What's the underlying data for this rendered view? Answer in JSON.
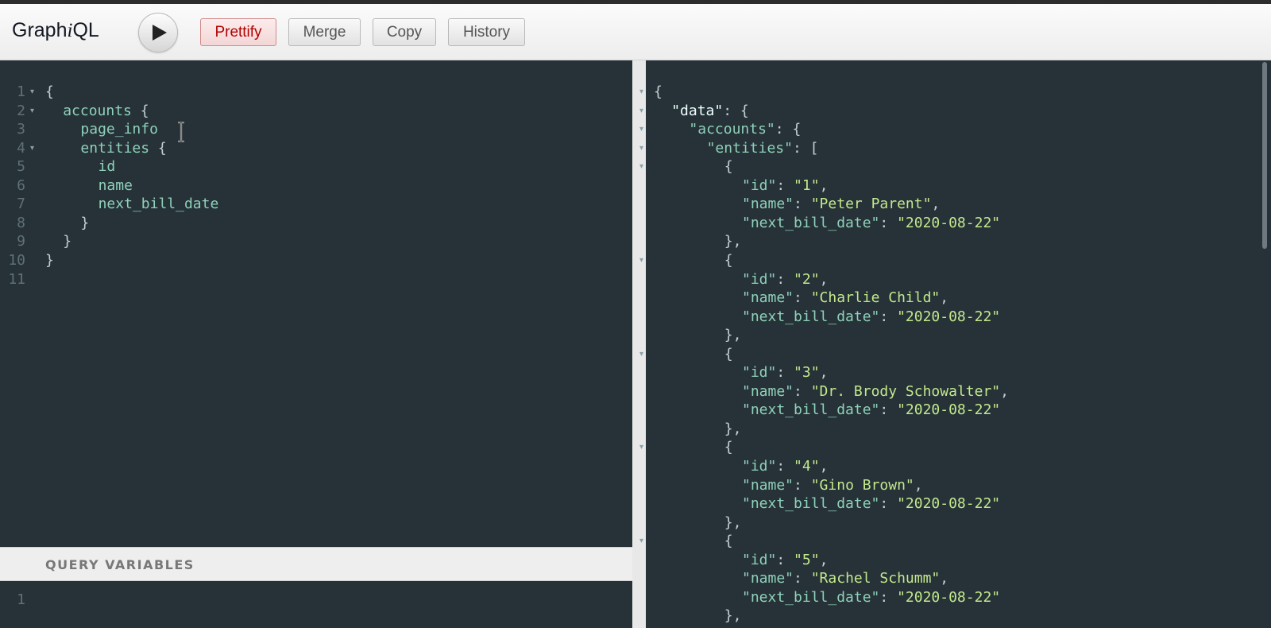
{
  "toolbar": {
    "title_pre": "Graph",
    "title_i": "i",
    "title_post": "QL",
    "buttons": {
      "prettify": "Prettify",
      "merge": "Merge",
      "copy": "Copy",
      "history": "History"
    },
    "execute_icon": "play-icon"
  },
  "query_editor": {
    "lines": [
      {
        "num": "1",
        "fold": true,
        "indent": 0,
        "tokens": [
          {
            "t": "{",
            "c": "punct"
          }
        ]
      },
      {
        "num": "2",
        "fold": true,
        "indent": 1,
        "tokens": [
          {
            "t": "accounts",
            "c": "field"
          },
          {
            "t": " {",
            "c": "punct"
          }
        ]
      },
      {
        "num": "3",
        "fold": false,
        "indent": 2,
        "tokens": [
          {
            "t": "page_info",
            "c": "field"
          }
        ]
      },
      {
        "num": "4",
        "fold": true,
        "indent": 2,
        "tokens": [
          {
            "t": "entities",
            "c": "field"
          },
          {
            "t": " {",
            "c": "punct"
          }
        ]
      },
      {
        "num": "5",
        "fold": false,
        "indent": 3,
        "tokens": [
          {
            "t": "id",
            "c": "field"
          }
        ]
      },
      {
        "num": "6",
        "fold": false,
        "indent": 3,
        "tokens": [
          {
            "t": "name",
            "c": "field"
          }
        ]
      },
      {
        "num": "7",
        "fold": false,
        "indent": 3,
        "tokens": [
          {
            "t": "next_bill_date",
            "c": "field"
          }
        ]
      },
      {
        "num": "8",
        "fold": false,
        "indent": 2,
        "tokens": [
          {
            "t": "}",
            "c": "punct"
          }
        ]
      },
      {
        "num": "9",
        "fold": false,
        "indent": 1,
        "tokens": [
          {
            "t": "}",
            "c": "punct"
          }
        ]
      },
      {
        "num": "10",
        "fold": false,
        "indent": 0,
        "tokens": [
          {
            "t": "}",
            "c": "punct"
          }
        ]
      },
      {
        "num": "11",
        "fold": false,
        "indent": 0,
        "tokens": []
      }
    ]
  },
  "query_variables": {
    "title": "QUERY VARIABLES",
    "lines": [
      {
        "num": "1"
      }
    ]
  },
  "result": {
    "lines": [
      {
        "fold": true,
        "indent": 0,
        "tokens": [
          {
            "t": "{",
            "c": "punct"
          }
        ]
      },
      {
        "fold": true,
        "indent": 1,
        "tokens": [
          {
            "t": "\"data\"",
            "c": "root"
          },
          {
            "t": ": {",
            "c": "punct"
          }
        ]
      },
      {
        "fold": true,
        "indent": 2,
        "tokens": [
          {
            "t": "\"accounts\"",
            "c": "key"
          },
          {
            "t": ": {",
            "c": "punct"
          }
        ]
      },
      {
        "fold": true,
        "indent": 3,
        "tokens": [
          {
            "t": "\"entities\"",
            "c": "key"
          },
          {
            "t": ": [",
            "c": "punct"
          }
        ]
      },
      {
        "fold": true,
        "indent": 4,
        "tokens": [
          {
            "t": "{",
            "c": "punct"
          }
        ]
      },
      {
        "fold": false,
        "indent": 5,
        "tokens": [
          {
            "t": "\"id\"",
            "c": "key"
          },
          {
            "t": ": ",
            "c": "punct"
          },
          {
            "t": "\"1\"",
            "c": "str"
          },
          {
            "t": ",",
            "c": "punct"
          }
        ]
      },
      {
        "fold": false,
        "indent": 5,
        "tokens": [
          {
            "t": "\"name\"",
            "c": "key"
          },
          {
            "t": ": ",
            "c": "punct"
          },
          {
            "t": "\"Peter Parent\"",
            "c": "str"
          },
          {
            "t": ",",
            "c": "punct"
          }
        ]
      },
      {
        "fold": false,
        "indent": 5,
        "tokens": [
          {
            "t": "\"next_bill_date\"",
            "c": "key"
          },
          {
            "t": ": ",
            "c": "punct"
          },
          {
            "t": "\"2020-08-22\"",
            "c": "str"
          }
        ]
      },
      {
        "fold": false,
        "indent": 4,
        "tokens": [
          {
            "t": "},",
            "c": "punct"
          }
        ]
      },
      {
        "fold": true,
        "indent": 4,
        "tokens": [
          {
            "t": "{",
            "c": "punct"
          }
        ]
      },
      {
        "fold": false,
        "indent": 5,
        "tokens": [
          {
            "t": "\"id\"",
            "c": "key"
          },
          {
            "t": ": ",
            "c": "punct"
          },
          {
            "t": "\"2\"",
            "c": "str"
          },
          {
            "t": ",",
            "c": "punct"
          }
        ]
      },
      {
        "fold": false,
        "indent": 5,
        "tokens": [
          {
            "t": "\"name\"",
            "c": "key"
          },
          {
            "t": ": ",
            "c": "punct"
          },
          {
            "t": "\"Charlie Child\"",
            "c": "str"
          },
          {
            "t": ",",
            "c": "punct"
          }
        ]
      },
      {
        "fold": false,
        "indent": 5,
        "tokens": [
          {
            "t": "\"next_bill_date\"",
            "c": "key"
          },
          {
            "t": ": ",
            "c": "punct"
          },
          {
            "t": "\"2020-08-22\"",
            "c": "str"
          }
        ]
      },
      {
        "fold": false,
        "indent": 4,
        "tokens": [
          {
            "t": "},",
            "c": "punct"
          }
        ]
      },
      {
        "fold": true,
        "indent": 4,
        "tokens": [
          {
            "t": "{",
            "c": "punct"
          }
        ]
      },
      {
        "fold": false,
        "indent": 5,
        "tokens": [
          {
            "t": "\"id\"",
            "c": "key"
          },
          {
            "t": ": ",
            "c": "punct"
          },
          {
            "t": "\"3\"",
            "c": "str"
          },
          {
            "t": ",",
            "c": "punct"
          }
        ]
      },
      {
        "fold": false,
        "indent": 5,
        "tokens": [
          {
            "t": "\"name\"",
            "c": "key"
          },
          {
            "t": ": ",
            "c": "punct"
          },
          {
            "t": "\"Dr. Brody Schowalter\"",
            "c": "str"
          },
          {
            "t": ",",
            "c": "punct"
          }
        ]
      },
      {
        "fold": false,
        "indent": 5,
        "tokens": [
          {
            "t": "\"next_bill_date\"",
            "c": "key"
          },
          {
            "t": ": ",
            "c": "punct"
          },
          {
            "t": "\"2020-08-22\"",
            "c": "str"
          }
        ]
      },
      {
        "fold": false,
        "indent": 4,
        "tokens": [
          {
            "t": "},",
            "c": "punct"
          }
        ]
      },
      {
        "fold": true,
        "indent": 4,
        "tokens": [
          {
            "t": "{",
            "c": "punct"
          }
        ]
      },
      {
        "fold": false,
        "indent": 5,
        "tokens": [
          {
            "t": "\"id\"",
            "c": "key"
          },
          {
            "t": ": ",
            "c": "punct"
          },
          {
            "t": "\"4\"",
            "c": "str"
          },
          {
            "t": ",",
            "c": "punct"
          }
        ]
      },
      {
        "fold": false,
        "indent": 5,
        "tokens": [
          {
            "t": "\"name\"",
            "c": "key"
          },
          {
            "t": ": ",
            "c": "punct"
          },
          {
            "t": "\"Gino Brown\"",
            "c": "str"
          },
          {
            "t": ",",
            "c": "punct"
          }
        ]
      },
      {
        "fold": false,
        "indent": 5,
        "tokens": [
          {
            "t": "\"next_bill_date\"",
            "c": "key"
          },
          {
            "t": ": ",
            "c": "punct"
          },
          {
            "t": "\"2020-08-22\"",
            "c": "str"
          }
        ]
      },
      {
        "fold": false,
        "indent": 4,
        "tokens": [
          {
            "t": "},",
            "c": "punct"
          }
        ]
      },
      {
        "fold": true,
        "indent": 4,
        "tokens": [
          {
            "t": "{",
            "c": "punct"
          }
        ]
      },
      {
        "fold": false,
        "indent": 5,
        "tokens": [
          {
            "t": "\"id\"",
            "c": "key"
          },
          {
            "t": ": ",
            "c": "punct"
          },
          {
            "t": "\"5\"",
            "c": "str"
          },
          {
            "t": ",",
            "c": "punct"
          }
        ]
      },
      {
        "fold": false,
        "indent": 5,
        "tokens": [
          {
            "t": "\"name\"",
            "c": "key"
          },
          {
            "t": ": ",
            "c": "punct"
          },
          {
            "t": "\"Rachel Schumm\"",
            "c": "str"
          },
          {
            "t": ",",
            "c": "punct"
          }
        ]
      },
      {
        "fold": false,
        "indent": 5,
        "tokens": [
          {
            "t": "\"next_bill_date\"",
            "c": "key"
          },
          {
            "t": ": ",
            "c": "punct"
          },
          {
            "t": "\"2020-08-22\"",
            "c": "str"
          }
        ]
      },
      {
        "fold": false,
        "indent": 4,
        "tokens": [
          {
            "t": "},",
            "c": "punct"
          }
        ]
      }
    ]
  }
}
